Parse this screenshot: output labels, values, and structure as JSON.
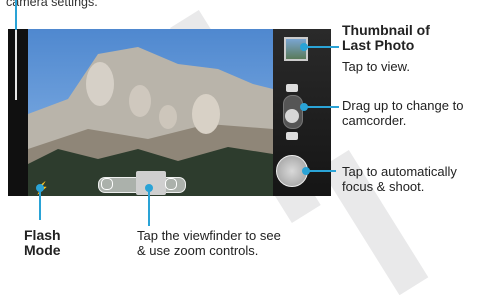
{
  "captions": {
    "top_left": "camera settings.",
    "thumbnail_title": "Thumbnail of Last Photo",
    "thumbnail_desc": "Tap to view.",
    "drag_desc": "Drag up to change to camcorder.",
    "shoot_desc": "Tap to automatically focus & shoot.",
    "flash_title": "Flash Mode",
    "zoom_desc": "Tap the viewfinder to see & use zoom controls."
  },
  "colors": {
    "callout": "#2aa3d6",
    "frame": "#1c1c1c"
  },
  "icons": {
    "flash": "flash-icon",
    "zoom_out": "zoom-out-icon",
    "zoom_in": "zoom-in-icon",
    "camcorder": "camcorder-icon",
    "camera": "camera-icon",
    "shutter": "shutter-icon"
  }
}
